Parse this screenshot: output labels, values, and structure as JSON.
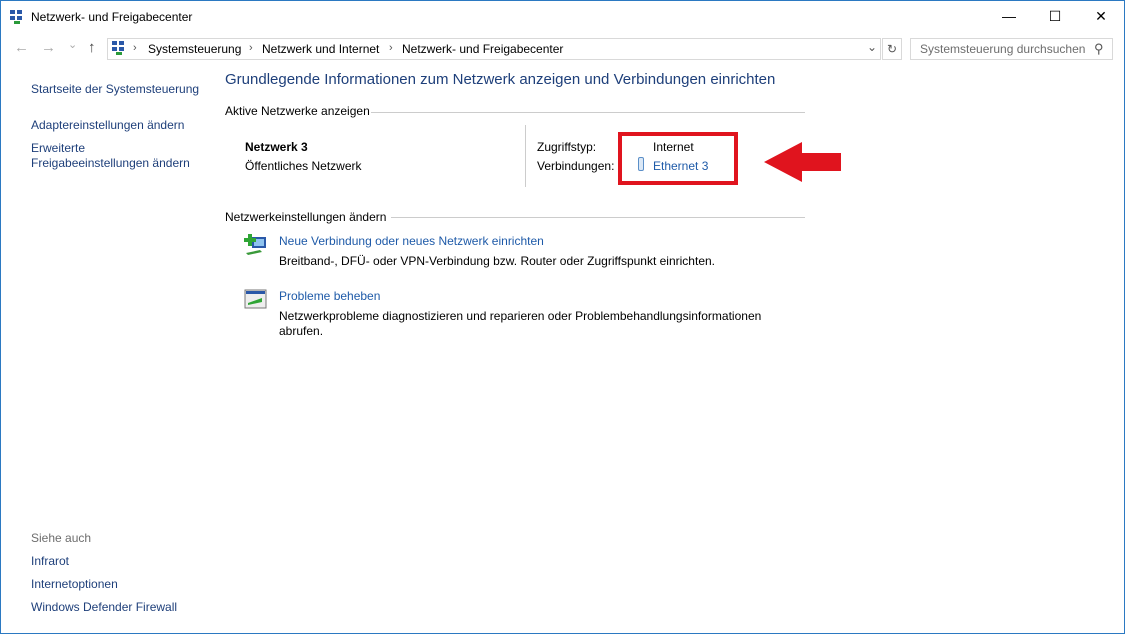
{
  "window": {
    "title": "Netzwerk- und Freigabecenter",
    "minimize": "—",
    "maximize": "☐",
    "close": "✕"
  },
  "nav": {
    "back": "←",
    "forward": "→",
    "recent": "⌄",
    "up": "↑",
    "breadcrumb": [
      "Systemsteuerung",
      "Netzwerk und Internet",
      "Netzwerk- und Freigabecenter"
    ],
    "dropdown": "⌄",
    "refresh": "↻",
    "search_placeholder": "Systemsteuerung durchsuchen"
  },
  "sidebar": {
    "items": [
      "Startseite der Systemsteuerung",
      "Adaptereinstellungen ändern",
      "Erweiterte Freigabeeinstellungen ändern"
    ],
    "see_also_title": "Siehe auch",
    "see_also": [
      "Infrarot",
      "Internetoptionen",
      "Windows Defender Firewall"
    ]
  },
  "main": {
    "heading": "Grundlegende Informationen zum Netzwerk anzeigen und Verbindungen einrichten",
    "active_title": "Aktive Netzwerke anzeigen",
    "network": {
      "name": "Netzwerk 3",
      "type": "Öffentliches Netzwerk",
      "access_label": "Zugriffstyp:",
      "access_value": "Internet",
      "conn_label": "Verbindungen:",
      "conn_value": "Ethernet 3"
    },
    "settings_title": "Netzwerkeinstellungen ändern",
    "tasks": [
      {
        "title": "Neue Verbindung oder neues Netzwerk einrichten",
        "desc": "Breitband-, DFÜ- oder VPN-Verbindung bzw. Router oder Zugriffspunkt einrichten."
      },
      {
        "title": "Probleme beheben",
        "desc": "Netzwerkprobleme diagnostizieren und reparieren oder Problembehandlungsinformationen abrufen."
      }
    ]
  },
  "annotation": {
    "highlight_color": "#e0141e"
  }
}
